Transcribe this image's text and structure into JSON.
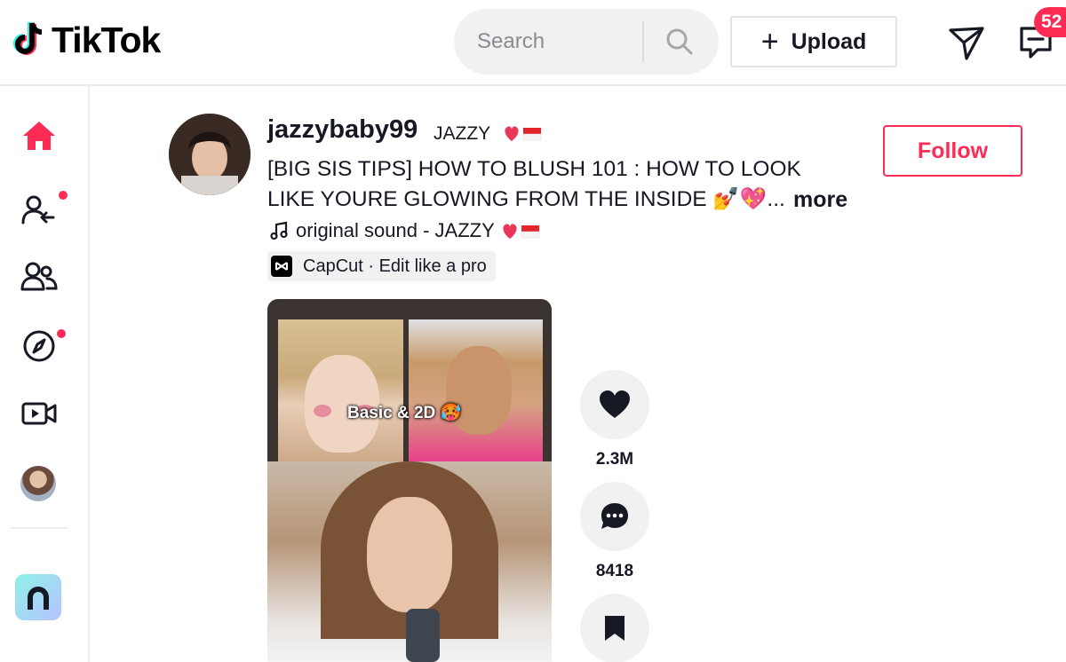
{
  "header": {
    "logo_text": "TikTok",
    "search": {
      "placeholder": "Search"
    },
    "upload_label": "Upload",
    "inbox_badge": "52"
  },
  "sidebar": {
    "items": [
      {
        "name": "home",
        "icon": "home-icon",
        "active": true
      },
      {
        "name": "following",
        "icon": "following-icon",
        "dot": true
      },
      {
        "name": "friends",
        "icon": "friends-icon"
      },
      {
        "name": "explore",
        "icon": "compass-icon",
        "dot": true
      },
      {
        "name": "live",
        "icon": "live-icon"
      },
      {
        "name": "profile",
        "icon": "avatar"
      }
    ]
  },
  "post": {
    "username": "jazzybaby99",
    "nickname": "JAZZY",
    "caption": "[BIG SIS TIPS] HOW TO BLUSH 101 : HOW TO LOOK LIKE YOURE GLOWING FROM THE INSIDE 💅💖...",
    "more_label": "more",
    "sound": "original sound - JAZZY",
    "capcut_label": "CapCut · Edit like a pro",
    "follow_label": "Follow",
    "video_overlay_text": "Basic & 2D 🥵",
    "likes": "2.3M",
    "comments": "8418"
  },
  "colors": {
    "accent": "#fe2c55",
    "text": "#161823",
    "surface": "#f1f1f2"
  }
}
